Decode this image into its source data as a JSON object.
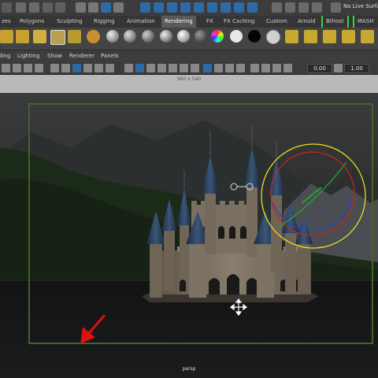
{
  "status_line": {
    "live_surface_label": "No Live Surfa"
  },
  "shelf_tabs": [
    {
      "label": "zes",
      "active": false
    },
    {
      "label": "Polygons",
      "active": false
    },
    {
      "label": "Sculpting",
      "active": false
    },
    {
      "label": "Rigging",
      "active": false
    },
    {
      "label": "Animation",
      "active": false
    },
    {
      "label": "Rendering",
      "active": true
    },
    {
      "label": "FX",
      "active": false
    },
    {
      "label": "FX Caching",
      "active": false
    },
    {
      "label": "Custom",
      "active": false
    },
    {
      "label": "Arnold",
      "active": false
    },
    {
      "label": "Bifrost",
      "active": false
    },
    {
      "label": "MASH",
      "active": false
    }
  ],
  "panel_menu": [
    "ding",
    "Lighting",
    "Show",
    "Renderer",
    "Panels"
  ],
  "panel_toolbar": {
    "exposure_value": "0.00",
    "gamma_value": "1.00"
  },
  "resolution_gate_label": "960 x 540",
  "camera_label": "persp",
  "colors": {
    "gate_border": "#48602a",
    "active_tab": "#5a5a5a",
    "manipulator_yellow": "#e8e01a",
    "manipulator_red": "#c0281e",
    "manipulator_green": "#2fa02f",
    "manipulator_blue": "#2a3ec8",
    "annotation_arrow": "#e01010"
  }
}
